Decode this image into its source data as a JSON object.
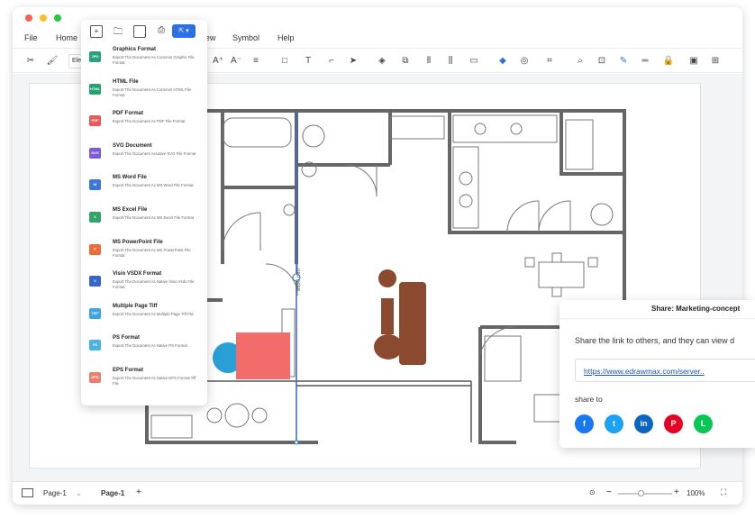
{
  "menu": {
    "file": "File",
    "home": "Home",
    "view": "View",
    "symbol": "Symbol",
    "help": "Help"
  },
  "toolbar": {
    "font_box": "Ele"
  },
  "export_menu": {
    "items": [
      {
        "badge": "JPG",
        "title": "Graphics Format",
        "desc": "Export The Document As Common Graphic File Format",
        "color": "#26a37b"
      },
      {
        "badge": "HTML",
        "title": "HTML File",
        "desc": "Export The Document As Common HTML File Format",
        "color": "#25a06f"
      },
      {
        "badge": "PDF",
        "title": "PDF Format",
        "desc": "Export The Document As PDF File Format",
        "color": "#e95b5b"
      },
      {
        "badge": "SVG",
        "title": "SVG Document",
        "desc": "Export The Document Asnative SVG File Format",
        "color": "#7b5bd6"
      },
      {
        "badge": "W",
        "title": "MS Word File",
        "desc": "Export The Document As MS Word File Format",
        "color": "#3a78e0"
      },
      {
        "badge": "X",
        "title": "MS Excel File",
        "desc": "Export The Document As MS Excel File Format",
        "color": "#2fa56a"
      },
      {
        "badge": "P",
        "title": "MS PowerPoint File",
        "desc": "Export The Document As MS PowerPoint File Format",
        "color": "#ef6b38"
      },
      {
        "badge": "V",
        "title": "Visio VSDX Format",
        "desc": "Export The Document As Native Visio Vsdx File Format",
        "color": "#3a64c6"
      },
      {
        "badge": "TIFF",
        "title": "Multiple Page Tiff",
        "desc": "Export The Document As Multiple Page Tiff File",
        "color": "#3fa3e4"
      },
      {
        "badge": "PS",
        "title": "PS Format",
        "desc": "Export The Document As Native PS Format",
        "color": "#47b1e8"
      },
      {
        "badge": "EPS",
        "title": "EPS Format",
        "desc": "Export The Document As Native EPS Format Tiff File",
        "color": "#ef7d6b"
      }
    ]
  },
  "share": {
    "title": "Share: Marketing-concept",
    "text": "Share the link to others, and they can view d",
    "link": "https://www.edrawmax.com/server..",
    "share_to": "share to"
  },
  "social": [
    {
      "name": "facebook-icon",
      "glyph": "f",
      "color": "#1877f2"
    },
    {
      "name": "twitter-icon",
      "glyph": "t",
      "color": "#1da1f2"
    },
    {
      "name": "linkedin-icon",
      "glyph": "in",
      "color": "#0a66c2"
    },
    {
      "name": "pinterest-icon",
      "glyph": "P",
      "color": "#e60023"
    },
    {
      "name": "line-icon",
      "glyph": "L",
      "color": "#06c755"
    }
  ],
  "drawing": {
    "dimension": "8890 mm"
  },
  "statusbar": {
    "page_select": "Page-1",
    "page_tab": "Page-1",
    "add": "+",
    "zoom": "100%"
  }
}
